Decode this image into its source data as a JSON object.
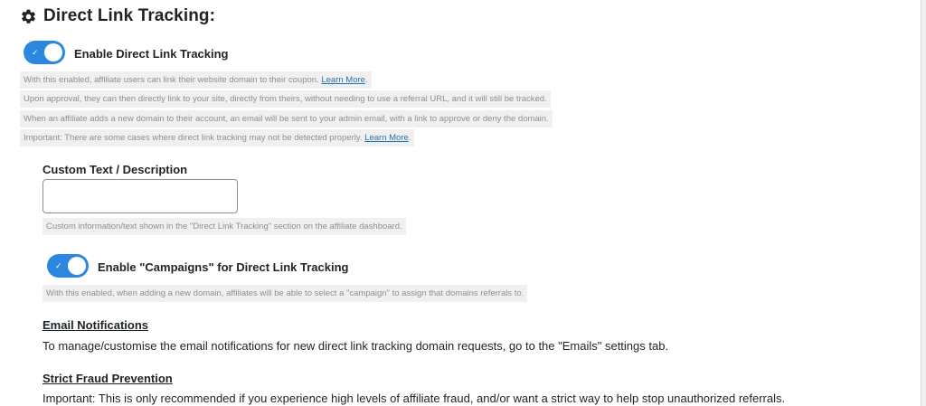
{
  "header": {
    "title": "Direct Link Tracking:",
    "icon": "gear-icon"
  },
  "main_toggle": {
    "label": "Enable Direct Link Tracking",
    "checked": true
  },
  "notes": [
    {
      "text": "With this enabled, affiliate users can link their website domain to their coupon.",
      "link": "Learn More",
      "suffix": "."
    },
    {
      "text": "Upon approval, they can then directly link to your site, directly from theirs, without needing to use a referral URL, and it will still be tracked."
    },
    {
      "text": "When an affiliate adds a new domain to their account, an email will be sent to your admin email, with a link to approve or deny the domain."
    },
    {
      "text": "Important: There are some cases where direct link tracking may not be detected properly.",
      "link": "Learn More",
      "suffix": "."
    }
  ],
  "custom_text": {
    "label": "Custom Text / Description",
    "value": "",
    "help": "Custom information/text shown in the \"Direct Link Tracking\" section on the affiliate dashboard."
  },
  "campaigns_toggle": {
    "label": "Enable \"Campaigns\" for Direct Link Tracking",
    "checked": true,
    "help": "With this enabled, when adding a new domain, affiliates will be able to select a \"campaign\" to assign that domains referrals to."
  },
  "email_notifications": {
    "heading": "Email Notifications",
    "text": "To manage/customise the email notifications for new direct link tracking domain requests, go to the \"Emails\" settings tab."
  },
  "strict_fraud": {
    "heading": "Strict Fraud Prevention",
    "text": "Important: This is only recommended if you experience high levels of affiliate fraud, and/or want a strict way to help stop unauthorized referrals."
  },
  "colors": {
    "toggle_on": "#2b87e0",
    "link": "#2271b1",
    "note_bg": "#f0f0f1"
  }
}
